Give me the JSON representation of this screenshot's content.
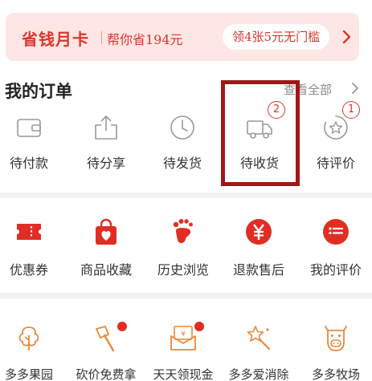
{
  "promo": {
    "title": "省钱月卡",
    "subtitle": "帮你省194元",
    "coupon": "领4张5元无门槛"
  },
  "orders": {
    "title": "我的订单",
    "view_all": "查看全部",
    "items": [
      {
        "label": "待付款",
        "icon": "wallet-icon"
      },
      {
        "label": "待分享",
        "icon": "share-icon"
      },
      {
        "label": "待发货",
        "icon": "clock-icon"
      },
      {
        "label": "待收货",
        "icon": "truck-icon",
        "badge": "2"
      },
      {
        "label": "待评价",
        "icon": "review-star-icon",
        "badge": "1"
      }
    ]
  },
  "services": {
    "items": [
      {
        "label": "优惠券",
        "icon": "coupon-icon"
      },
      {
        "label": "商品收藏",
        "icon": "favorite-bag-icon"
      },
      {
        "label": "历史浏览",
        "icon": "footprint-icon"
      },
      {
        "label": "退款售后",
        "icon": "refund-yen-icon"
      },
      {
        "label": "我的评价",
        "icon": "my-review-icon"
      }
    ]
  },
  "games": {
    "items": [
      {
        "label": "多多果园",
        "icon": "tree-icon"
      },
      {
        "label": "砍价免费拿",
        "icon": "axe-icon"
      },
      {
        "label": "天天领现金",
        "icon": "cash-envelope-icon"
      },
      {
        "label": "多多爱消除",
        "icon": "star-wand-icon"
      },
      {
        "label": "多多牧场",
        "icon": "cow-icon"
      }
    ]
  },
  "colors": {
    "accent": "#e02e24",
    "promo_bg": "#fde6e3",
    "highlight": "#a31517",
    "game_icon": "#e8893a"
  }
}
